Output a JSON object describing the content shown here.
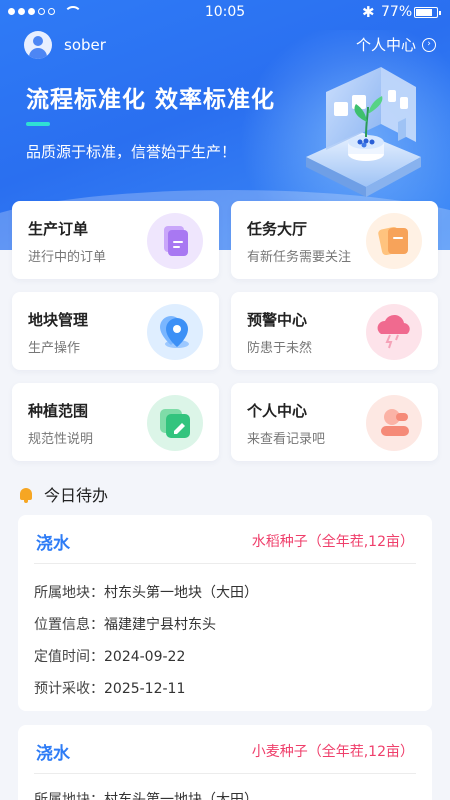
{
  "status_bar": {
    "time": "10:05",
    "battery": "77%"
  },
  "header": {
    "username": "sober",
    "center_link": "个人中心",
    "headline": "流程标准化 效率标准化",
    "slogan": "品质源于标准，信誉始于生产！"
  },
  "menu": [
    {
      "title": "生产订单",
      "subtitle": "进行中的订单",
      "icon": "order-icon",
      "color": "#a878f2"
    },
    {
      "title": "任务大厅",
      "subtitle": "有新任务需要关注",
      "icon": "task-icon",
      "color": "#f7a35a"
    },
    {
      "title": "地块管理",
      "subtitle": "生产操作",
      "icon": "location-pin-icon",
      "color": "#3c90f6"
    },
    {
      "title": "预警中心",
      "subtitle": "防患于未然",
      "icon": "cloud-alert-icon",
      "color": "#f06a8f"
    },
    {
      "title": "种植范围",
      "subtitle": "规范性说明",
      "icon": "edit-note-icon",
      "color": "#33c47e"
    },
    {
      "title": "个人中心",
      "subtitle": "来查看记录吧",
      "icon": "user-icon",
      "color": "#f58a78"
    }
  ],
  "todo": {
    "title": "今日待办",
    "tasks": [
      {
        "name": "浇水",
        "seed": "水稻种子（全年茬,12亩）",
        "field_label": "所属地块：",
        "field": "村东头第一地块（大田）",
        "location_label": "位置信息：",
        "location": "福建建宁县村东头",
        "planted_label": "定值时间：",
        "planted": "2024-09-22",
        "harvest_label": "预计采收：",
        "harvest": "2025-12-11"
      },
      {
        "name": "浇水",
        "seed": "小麦种子（全年茬,12亩）",
        "field_label": "所属地块：",
        "field": "村东头第一地块（大田）"
      }
    ]
  }
}
